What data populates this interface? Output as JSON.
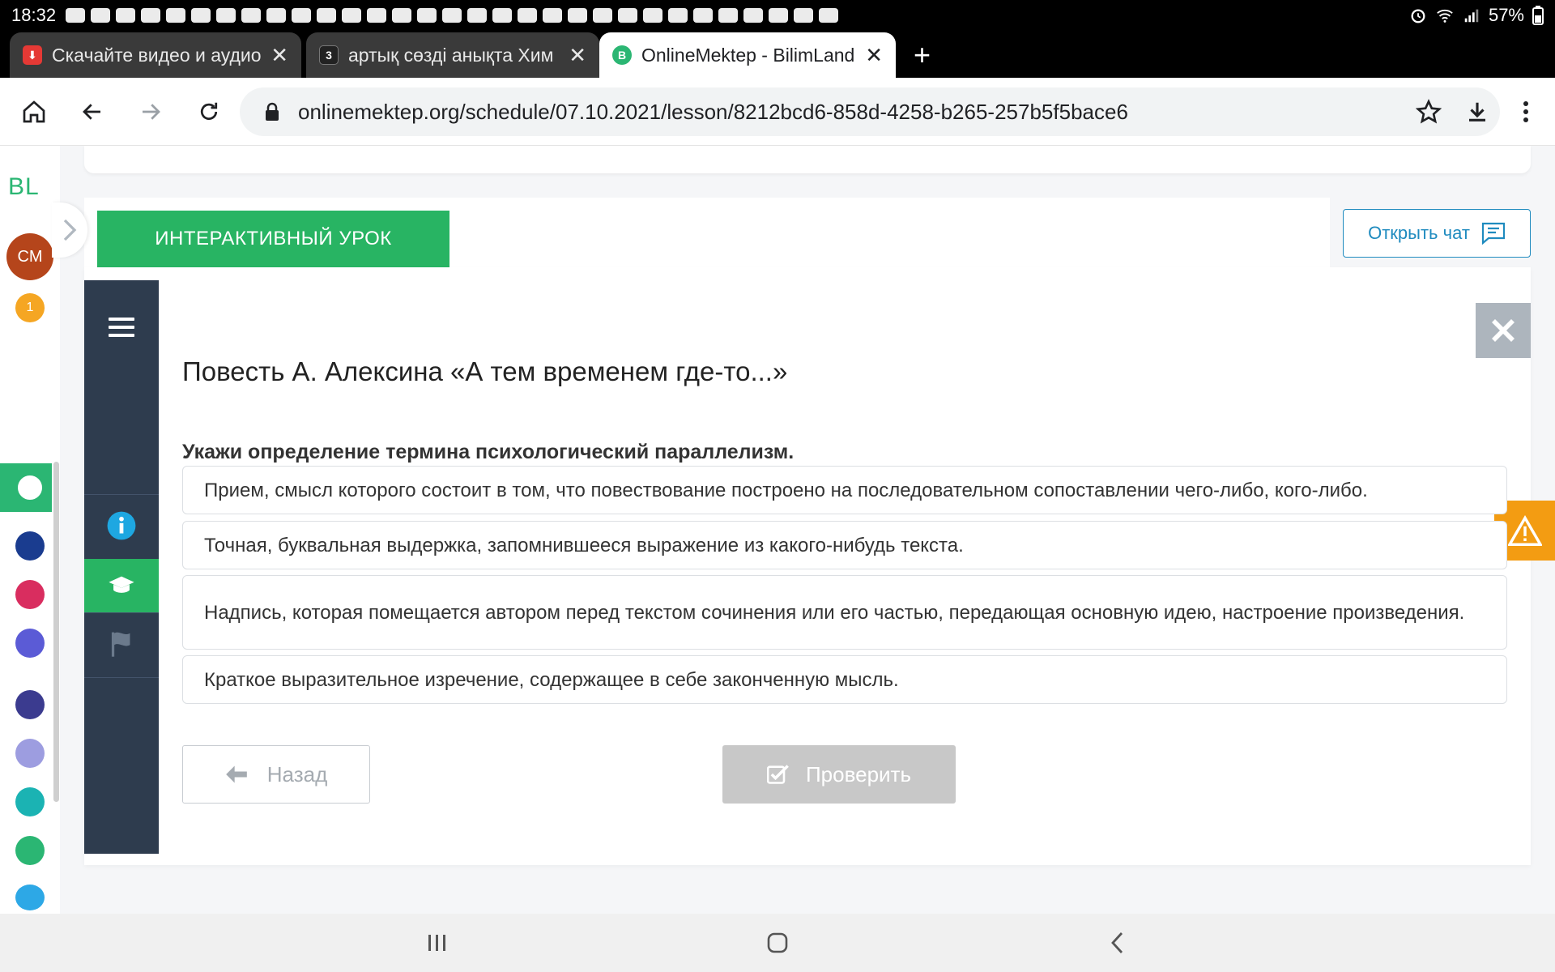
{
  "status_bar": {
    "time": "18:32",
    "battery": "57%"
  },
  "tabs": [
    {
      "title": "Скачайте видео и аудио",
      "favicon_color": "#e53935",
      "favicon_glyph": "⬇"
    },
    {
      "title": "артық сөзді анықта Хим",
      "favicon_color": "#222222",
      "favicon_glyph": "3"
    },
    {
      "title": "OnlineMektep - BilimLand",
      "favicon_color": "#2bb673",
      "favicon_glyph": "B"
    }
  ],
  "toolbar": {
    "url": "onlinemektep.org/schedule/07.10.2021/lesson/8212bcd6-858d-4258-b265-257b5f5bace6",
    "icons": [
      "home-icon",
      "back-arrow-icon",
      "forward-arrow-icon",
      "reload-icon",
      "lock-icon",
      "star-icon",
      "download-icon",
      "more-vert-icon"
    ]
  },
  "rail": {
    "logo": "BL",
    "user_initials": "CM",
    "notification_count": "1",
    "apps": [
      {
        "name": "online-mektep",
        "color": "#2bb673"
      },
      {
        "name": "bilim-tutor",
        "color": "#1a3c8f"
      },
      {
        "name": "bilim-shop",
        "color": "#d92d5f"
      },
      {
        "name": "bilim-market",
        "color": "#5b5bd6"
      },
      {
        "name": "smart-nation",
        "color": "#3b3b8f"
      },
      {
        "name": "news",
        "color": "#9d9de0"
      },
      {
        "name": "bilim-center",
        "color": "#1bb3b3"
      },
      {
        "name": "bilim-land",
        "color": "#2bb673"
      },
      {
        "name": "itest",
        "color": "#2da8e6"
      }
    ]
  },
  "lesson": {
    "label": "ИНТЕРАКТИВНЫЙ УРОК",
    "open_chat": "Открыть чат",
    "title": "Повесть А. Алексина «А тем временем где-то...»",
    "question": "Укажи определение термина психологический параллелизм.",
    "options": [
      "Прием, смысл которого состоит в том, что повествование построено на последовательном сопоставлении чего-либо, кого-либо.",
      "Точная, буквальная выдержка, запомнившееся выражение из какого-нибудь текста.",
      "Надпись, которая помещается автором перед текстом сочинения или его частью, передающая основную идею, настроение произведения.",
      "Краткое выразительное изречение, содержащее в себе законченную мысль."
    ],
    "back": "Назад",
    "check": "Проверить"
  },
  "colors": {
    "accent_green": "#28b463",
    "sidenav_dark": "#2e3c4e",
    "chat_blue": "#1f8bbf",
    "warning_orange": "#f39c12"
  }
}
